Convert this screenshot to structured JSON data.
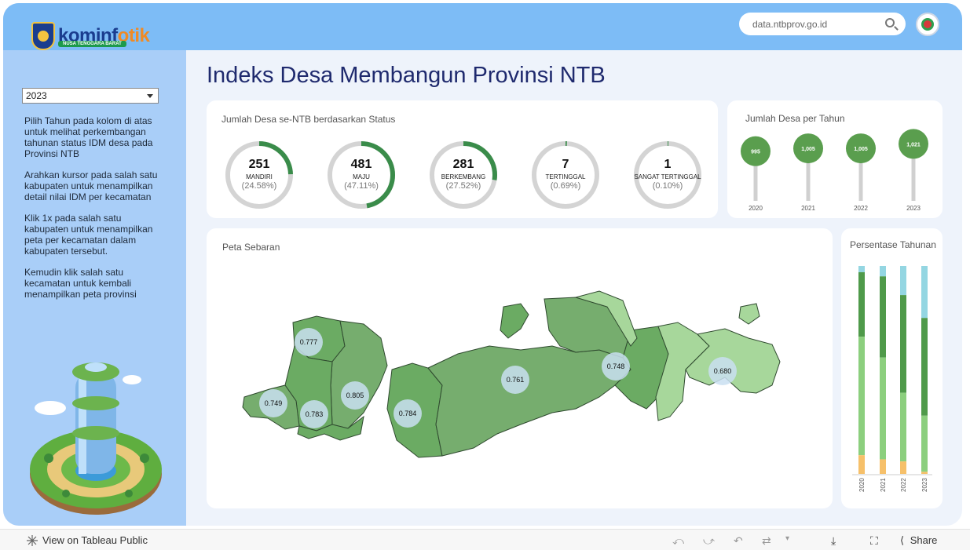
{
  "sidebar": {
    "logo_main": "kominf",
    "logo_accent": "otik",
    "logo_sub": "NUSA TENGGARA BARAT",
    "year_selected": "2023",
    "instructions": [
      "Pilih Tahun pada kolom di atas untuk melihat perkembangan tahunan status IDM desa pada Provinsi NTB",
      "Arahkan kursor pada salah satu kabupaten untuk menampilkan detail nilai IDM per kecamatan",
      "Klik 1x pada salah satu kabupaten untuk menampilkan peta per kecamatan dalam kabupaten tersebut.",
      "Kemudin klik salah satu kecamatan untuk kembali menampilkan peta provinsi"
    ]
  },
  "header": {
    "search_text": "data.ntbprov.go.id",
    "page_title": "Indeks Desa Membangun Provinsi NTB"
  },
  "status_card": {
    "title": "Jumlah Desa se-NTB berdasarkan Status",
    "items": [
      {
        "count": "251",
        "label": "MANDIRI",
        "pct_text": "(24.58%)",
        "pct": 0.2458
      },
      {
        "count": "481",
        "label": "MAJU",
        "pct_text": "(47.11%)",
        "pct": 0.4711
      },
      {
        "count": "281",
        "label": "BERKEMBANG",
        "pct_text": "(27.52%)",
        "pct": 0.2752
      },
      {
        "count": "7",
        "label": "TERTINGGAL",
        "pct_text": "(0.69%)",
        "pct": 0.0069
      },
      {
        "count": "1",
        "label": "SANGAT TERTINGGAL",
        "pct_text": "(0.10%)",
        "pct": 0.001
      }
    ],
    "colors": {
      "ring": "#d4d4d4",
      "fill": "#3a8c4a"
    }
  },
  "year_card": {
    "title": "Jumlah Desa per Tahun",
    "years": [
      "2020",
      "2021",
      "2022",
      "2023"
    ],
    "values": [
      "995",
      "1,005",
      "1,005",
      "1,021"
    ],
    "raw": [
      995,
      1005,
      1005,
      1021
    ],
    "color": "#5a9e4e"
  },
  "map_card": {
    "title": "Peta Sebaran",
    "bubbles": [
      "0.777",
      "0.749",
      "0.783",
      "0.805",
      "0.784",
      "0.761",
      "0.748",
      "0.680"
    ],
    "colors": {
      "dark": "#76ad6e",
      "mid": "#6bab63",
      "light": "#a7d79b",
      "bubble": "#c9dff1"
    }
  },
  "pct_card": {
    "title": "Persentase Tahunan",
    "years": [
      "2020",
      "2021",
      "2022",
      "2023"
    ],
    "segments": [
      {
        "name": "top",
        "color": "#94d6e2",
        "values": [
          0.03,
          0.05,
          0.14,
          0.25
        ]
      },
      {
        "name": "dark",
        "color": "#4f9a4a",
        "values": [
          0.31,
          0.39,
          0.47,
          0.47
        ]
      },
      {
        "name": "light",
        "color": "#8ccf7e",
        "values": [
          0.57,
          0.49,
          0.33,
          0.27
        ]
      },
      {
        "name": "orange",
        "color": "#f6c06a",
        "values": [
          0.09,
          0.07,
          0.06,
          0.01
        ]
      }
    ]
  },
  "footer": {
    "view_label": "View on Tableau Public",
    "share_label": "Share"
  }
}
